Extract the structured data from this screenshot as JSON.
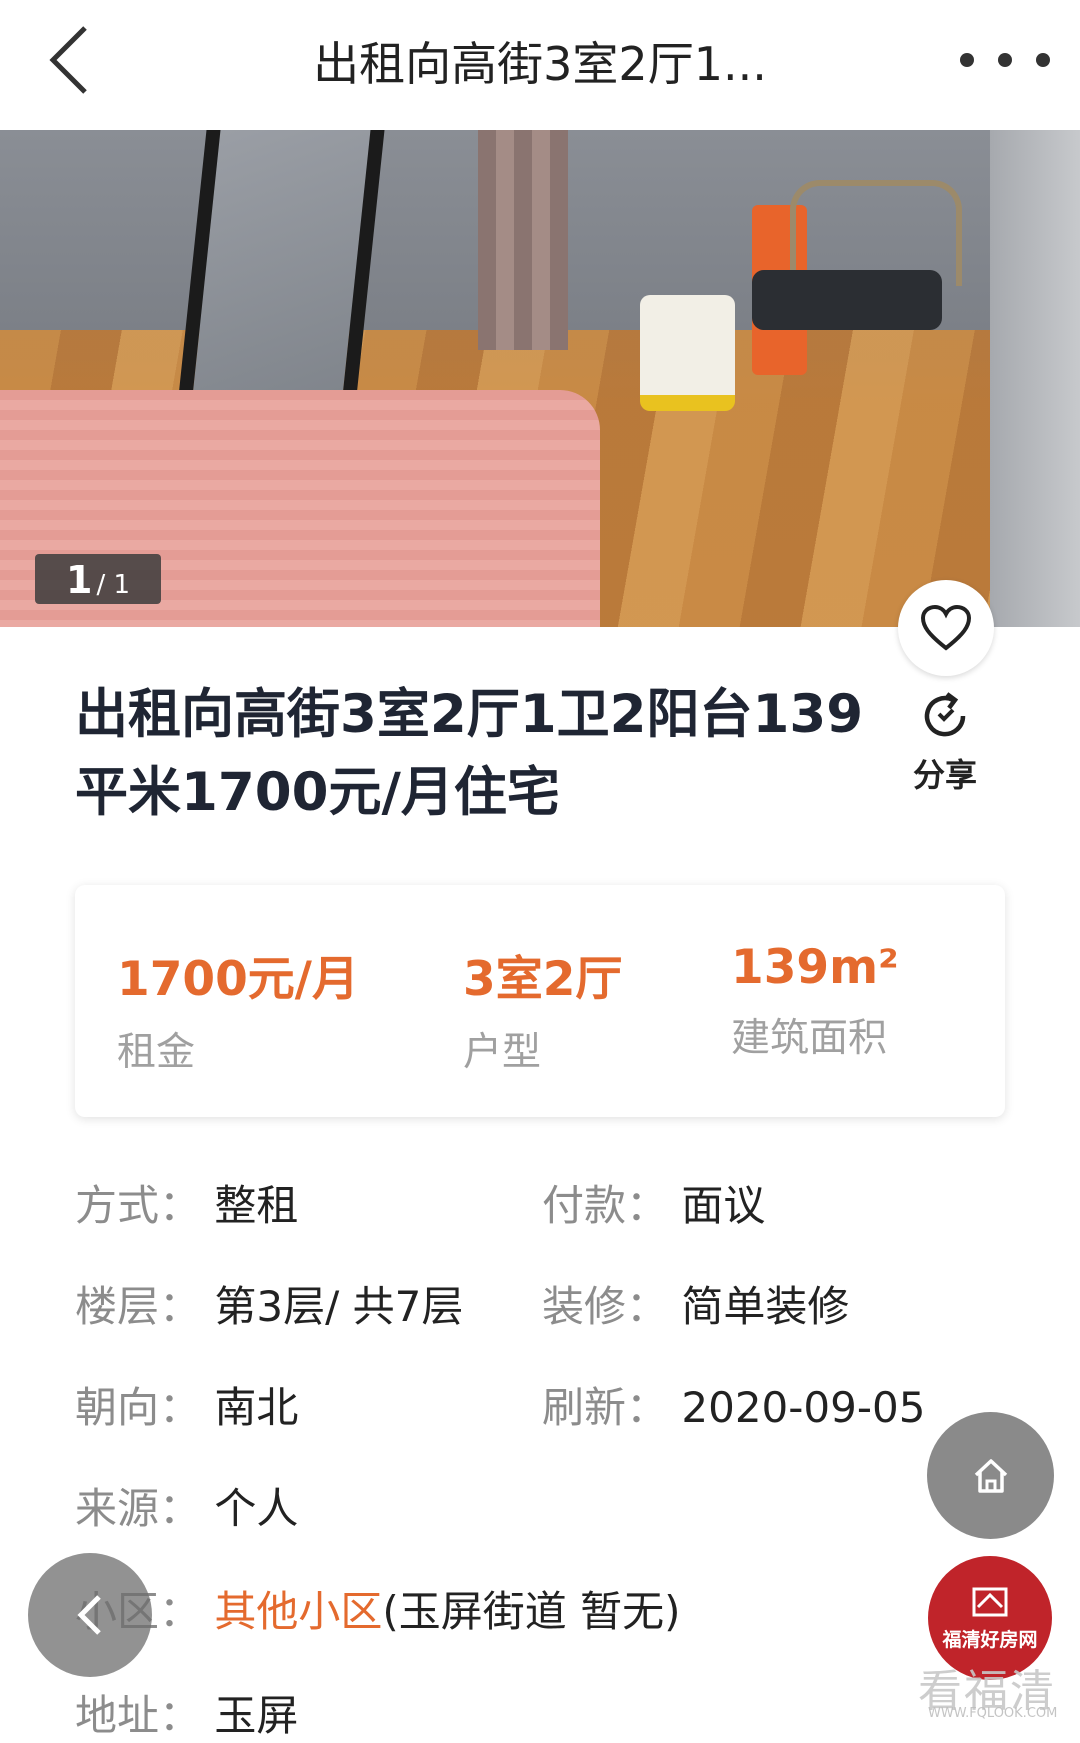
{
  "header": {
    "title": "出租向高街3室2厅1...",
    "back_icon": "chevron-left-icon",
    "more_icon": "more-dots-icon"
  },
  "photo": {
    "current": "1",
    "total": "/ 1"
  },
  "listing": {
    "title": "出租向高街3室2厅1卫2阳台139平米1700元/月住宅",
    "share_label": "分享"
  },
  "summary": {
    "rent_value": "1700元/月",
    "rent_label": "租金",
    "layout_value": "3室2厅",
    "layout_label": "户型",
    "area_value": "139m²",
    "area_label": "建筑面积"
  },
  "details": {
    "mode": {
      "key": "方式：",
      "value": "整租"
    },
    "payment": {
      "key": "付款：",
      "value": "面议"
    },
    "floor": {
      "key": "楼层：",
      "value": "第3层/ 共7层"
    },
    "decoration": {
      "key": "装修：",
      "value": "简单装修"
    },
    "orientation": {
      "key": "朝向：",
      "value": "南北"
    },
    "refresh": {
      "key": "刷新：",
      "value": "2020-09-05"
    },
    "source": {
      "key": "来源：",
      "value": "个人"
    },
    "community": {
      "key": "小区：",
      "link": "其他小区",
      "extra": "(玉屏街道 暂无)"
    },
    "address": {
      "key": "地址：",
      "value": "玉屏"
    }
  },
  "overlay": {
    "logo_text": "福清好房网",
    "watermark": "看福清",
    "watermark_url": "WWW.FQLOOK.COM"
  },
  "colors": {
    "accent": "#e46a2e",
    "title": "#1f2533",
    "label_gray": "#8c8c8c",
    "logo_red": "#c0242a"
  }
}
